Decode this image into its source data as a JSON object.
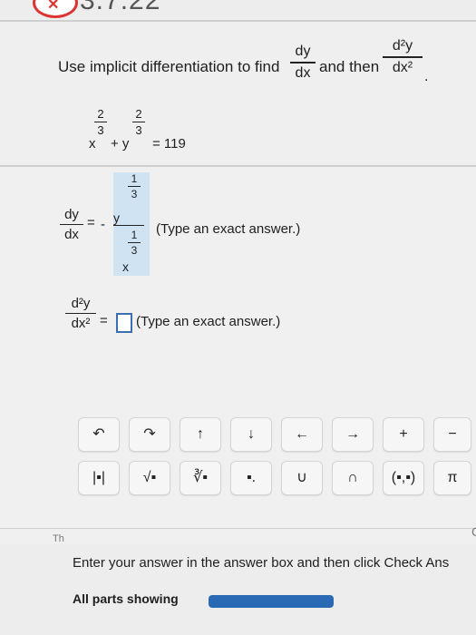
{
  "header": {
    "problem_number": "3.7.22",
    "status_icon": "wrong-x-icon"
  },
  "instruction": {
    "text": "Use implicit differentiation to find",
    "and_then": "and then",
    "frac1_num": "dy",
    "frac1_den": "dx",
    "frac2_num": "d²y",
    "frac2_den": "dx²"
  },
  "equation": {
    "exp_num": "2",
    "exp_den": "3",
    "base_x": "x",
    "base_y": "+ y",
    "rhs": "= 119"
  },
  "first_answer": {
    "label_num": "dy",
    "label_den": "dx",
    "equals": "=",
    "minus": "-",
    "y": "y",
    "x": "x",
    "exp_num": "1",
    "exp_den": "3",
    "hint": "(Type an exact answer.)"
  },
  "second_answer": {
    "label_num": "d²y",
    "label_den": "dx²",
    "equals": "=",
    "hint": "(Type an exact answer.)"
  },
  "toolbar": {
    "row1": [
      "↶",
      "↷",
      "↑",
      "↓",
      "←",
      "→",
      "+",
      "−"
    ],
    "row2": [
      "|▪|",
      "√▪",
      "∛▪",
      "▪.",
      "∪",
      "∩",
      "(▪,▪)",
      "π"
    ]
  },
  "footer": {
    "instruction": "Enter your answer in the answer box and then click Check Ans",
    "parts_showing": "All parts showing",
    "clipped_left_1": "Th",
    "clipped_left_2": "Cl",
    "clipped_right": "C"
  },
  "colors": {
    "accent": "#2a6ab5",
    "error": "#dd3333",
    "filled_bg": "#cfe3f3"
  }
}
